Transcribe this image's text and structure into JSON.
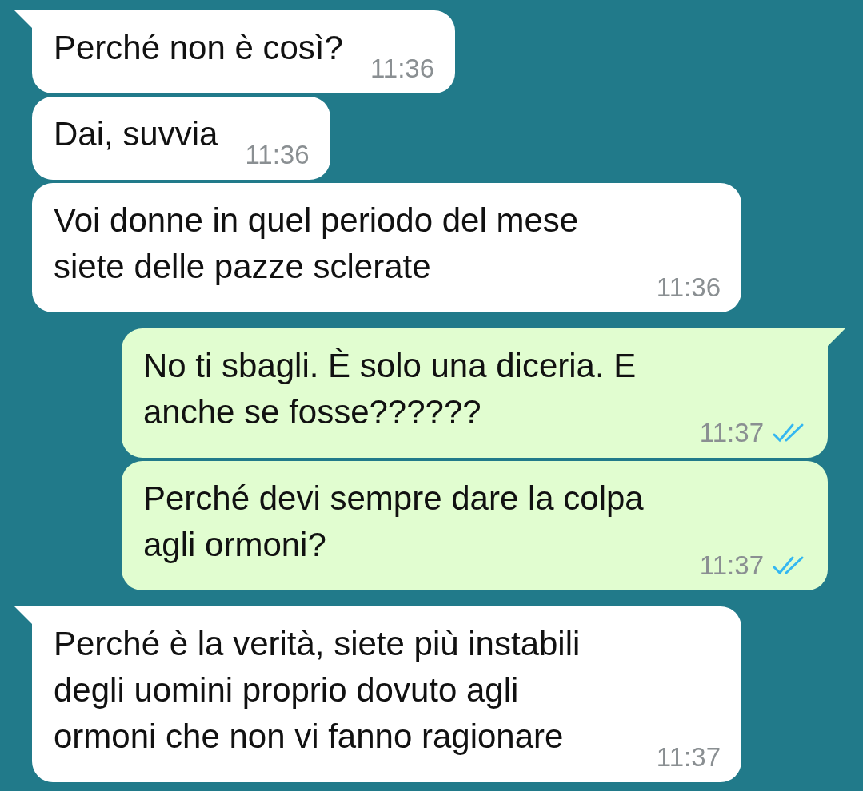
{
  "messages": [
    {
      "kind": "incoming",
      "tail": true,
      "text": "Perché non è così?",
      "time": "11:36"
    },
    {
      "kind": "incoming",
      "tail": false,
      "text": "Dai, suvvia",
      "time": "11:36"
    },
    {
      "kind": "incoming",
      "tail": false,
      "text": "Voi donne in quel periodo del mese siete delle pazze sclerate",
      "time": "11:36"
    },
    {
      "kind": "outgoing",
      "tail": true,
      "text": "No ti sbagli. È solo una diceria. E anche se fosse??????",
      "time": "11:37",
      "read": true
    },
    {
      "kind": "outgoing",
      "tail": false,
      "text": "Perché devi sempre dare la colpa agli ormoni?",
      "time": "11:37",
      "read": true
    },
    {
      "kind": "incoming",
      "tail": true,
      "text": "Perché è la verità, siete più instabili degli uomini proprio dovuto agli ormoni che non vi fanno ragionare",
      "time": "11:37"
    }
  ]
}
